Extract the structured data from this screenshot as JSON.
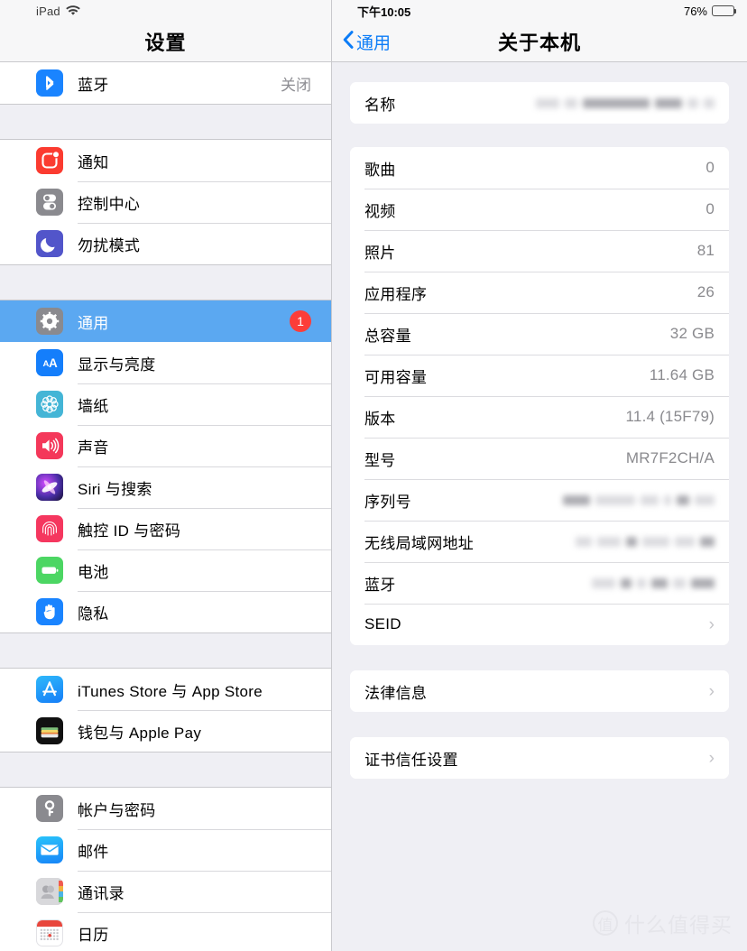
{
  "sidebar": {
    "status": {
      "device": "iPad",
      "wifi_icon": "wifi-icon"
    },
    "title": "设置",
    "groups": [
      {
        "items": [
          {
            "icon": "bluetooth-icon",
            "label": "蓝牙",
            "value": "关闭",
            "key": "bluetooth"
          }
        ]
      },
      {
        "items": [
          {
            "icon": "notifications-icon",
            "label": "通知",
            "value": "",
            "key": "notifications"
          },
          {
            "icon": "control-center-icon",
            "label": "控制中心",
            "value": "",
            "key": "control-center"
          },
          {
            "icon": "do-not-disturb-icon",
            "label": "勿扰模式",
            "value": "",
            "key": "do-not-disturb"
          }
        ]
      },
      {
        "items": [
          {
            "icon": "gear-icon",
            "label": "通用",
            "value": "",
            "badge": "1",
            "selected": true,
            "key": "general"
          },
          {
            "icon": "display-brightness-icon",
            "label": "显示与亮度",
            "value": "",
            "key": "display"
          },
          {
            "icon": "wallpaper-icon",
            "label": "墙纸",
            "value": "",
            "key": "wallpaper"
          },
          {
            "icon": "sound-icon",
            "label": "声音",
            "value": "",
            "key": "sounds"
          },
          {
            "icon": "siri-icon",
            "label": "Siri 与搜索",
            "value": "",
            "key": "siri"
          },
          {
            "icon": "touch-id-icon",
            "label": "触控 ID 与密码",
            "value": "",
            "key": "touch-id"
          },
          {
            "icon": "battery-icon",
            "label": "电池",
            "value": "",
            "key": "battery"
          },
          {
            "icon": "privacy-hand-icon",
            "label": "隐私",
            "value": "",
            "key": "privacy"
          }
        ]
      },
      {
        "items": [
          {
            "icon": "app-store-icon",
            "label": "iTunes Store 与 App Store",
            "value": "",
            "key": "itunes-store"
          },
          {
            "icon": "wallet-icon",
            "label": "钱包与 Apple Pay",
            "value": "",
            "key": "wallet"
          }
        ]
      },
      {
        "items": [
          {
            "icon": "key-icon",
            "label": "帐户与密码",
            "value": "",
            "key": "accounts"
          },
          {
            "icon": "mail-icon",
            "label": "邮件",
            "value": "",
            "key": "mail"
          },
          {
            "icon": "contacts-icon",
            "label": "通讯录",
            "value": "",
            "key": "contacts"
          },
          {
            "icon": "calendar-icon",
            "label": "日历",
            "value": "",
            "key": "calendar"
          }
        ]
      }
    ]
  },
  "detail": {
    "status": {
      "time": "下午10:05",
      "battery_percent": "76%",
      "battery_level": 76
    },
    "back_label": "通用",
    "title": "关于本机",
    "sections": [
      {
        "rows": [
          {
            "key": "name",
            "label": "名称",
            "value": "",
            "redacted": true,
            "chevron": false
          }
        ]
      },
      {
        "rows": [
          {
            "key": "songs",
            "label": "歌曲",
            "value": "0",
            "redacted": false,
            "chevron": false
          },
          {
            "key": "videos",
            "label": "视频",
            "value": "0",
            "redacted": false,
            "chevron": false
          },
          {
            "key": "photos",
            "label": "照片",
            "value": "81",
            "redacted": false,
            "chevron": false
          },
          {
            "key": "applications",
            "label": "应用程序",
            "value": "26",
            "redacted": false,
            "chevron": false
          },
          {
            "key": "capacity",
            "label": "总容量",
            "value": "32 GB",
            "redacted": false,
            "chevron": false
          },
          {
            "key": "available",
            "label": "可用容量",
            "value": "11.64 GB",
            "redacted": false,
            "chevron": false
          },
          {
            "key": "version",
            "label": "版本",
            "value": "11.4 (15F79)",
            "redacted": false,
            "chevron": false
          },
          {
            "key": "model",
            "label": "型号",
            "value": "MR7F2CH/A",
            "redacted": false,
            "chevron": false
          },
          {
            "key": "serial-number",
            "label": "序列号",
            "value": "",
            "redacted": true,
            "chevron": false
          },
          {
            "key": "wifi-address",
            "label": "无线局域网地址",
            "value": "",
            "redacted": true,
            "chevron": false
          },
          {
            "key": "bluetooth-address",
            "label": "蓝牙",
            "value": "",
            "redacted": true,
            "chevron": false
          },
          {
            "key": "seid",
            "label": "SEID",
            "value": "",
            "redacted": false,
            "chevron": true
          }
        ]
      },
      {
        "rows": [
          {
            "key": "legal",
            "label": "法律信息",
            "value": "",
            "redacted": false,
            "chevron": true
          }
        ]
      },
      {
        "rows": [
          {
            "key": "certificate-trust",
            "label": "证书信任设置",
            "value": "",
            "redacted": false,
            "chevron": true
          }
        ]
      }
    ]
  },
  "watermark": {
    "badge": "值",
    "text": "什么值得买"
  },
  "colors": {
    "selection_blue": "#5ba8f1",
    "accent_blue": "#0b7cf7",
    "badge_red": "#fc3d39",
    "group_bg": "#efeff4",
    "value_gray": "#8a8a8e"
  }
}
